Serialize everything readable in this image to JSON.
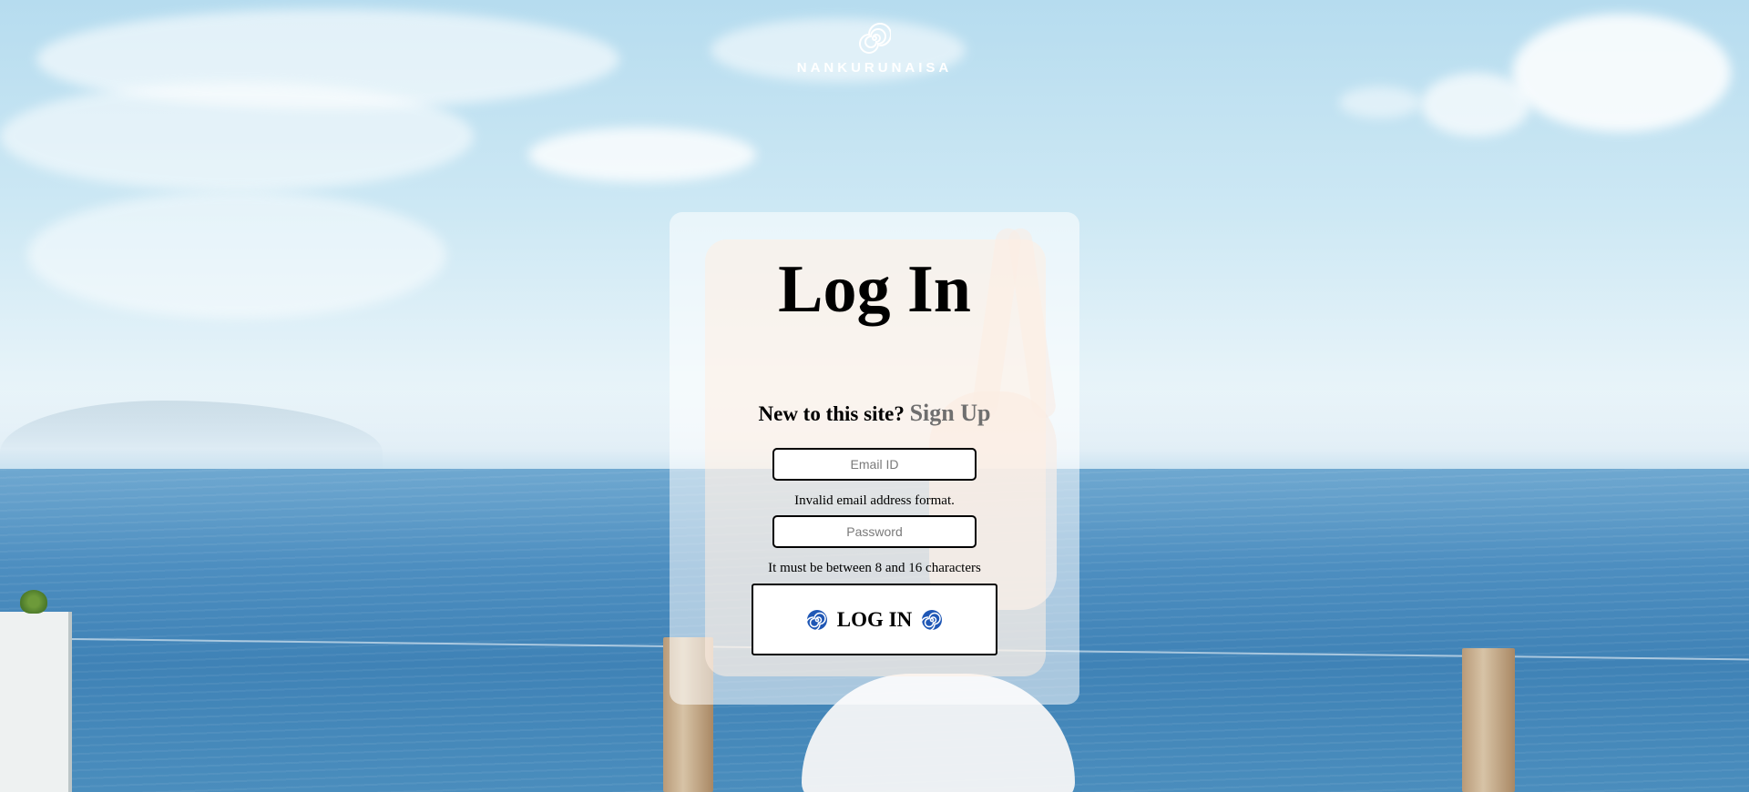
{
  "brand": {
    "name": "NANKURUNAISA",
    "logo_icon": "spiral-icon"
  },
  "login_card": {
    "title": "Log In",
    "signup_prompt": "New to this site?",
    "signup_link": "Sign Up",
    "email": {
      "placeholder": "Email ID",
      "value": "",
      "error": "Invalid email address format."
    },
    "password": {
      "placeholder": "Password",
      "value": "",
      "hint": "It must be between 8 and 16 characters"
    },
    "submit": {
      "label": "LOG IN",
      "icon": "spiral-icon"
    }
  },
  "colors": {
    "sky": "#cde8f4",
    "sea": "#4d8ec0",
    "card_overlay": "#ffeee2",
    "signup_link": "#6f6f6f",
    "spiral_icon": "#1f57b5",
    "text": "#000000"
  }
}
